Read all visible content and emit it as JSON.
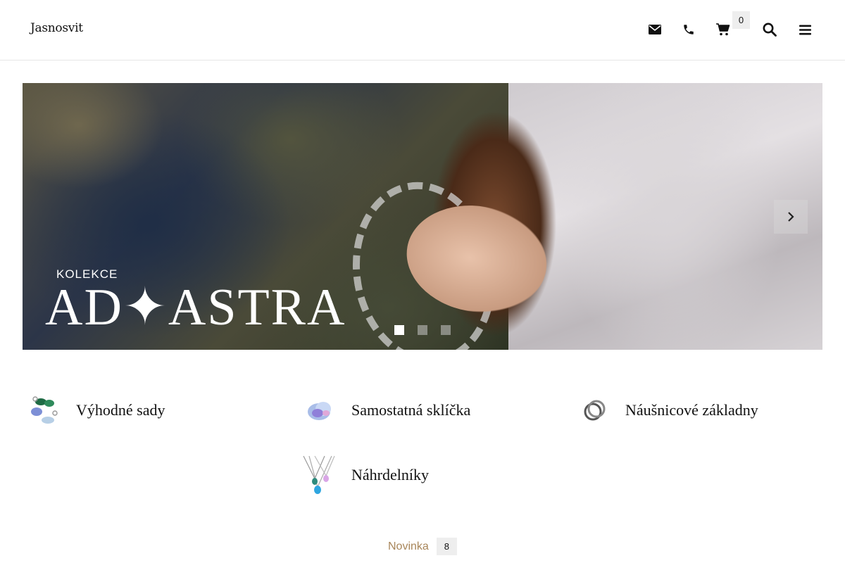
{
  "header": {
    "logo_text": "Jasnosvit",
    "cart_count": "0"
  },
  "banner": {
    "kicker": "KOLEKCE",
    "title": "AD✦ASTRA",
    "slides_total": 3,
    "active_slide": 1
  },
  "categories": [
    {
      "label": "Výhodné sady",
      "icon": "jewelry-set-icon"
    },
    {
      "label": "Samostatná sklíčka",
      "icon": "glass-drop-icon"
    },
    {
      "label": "Náušnicové základny",
      "icon": "earring-base-icon"
    },
    {
      "label": "Náhrdelníky",
      "icon": "necklace-icon"
    }
  ],
  "novinka": {
    "label": "Novinka",
    "count": "8"
  },
  "colors": {
    "accent": "#a8865a",
    "badge_bg": "#eeeeee"
  }
}
